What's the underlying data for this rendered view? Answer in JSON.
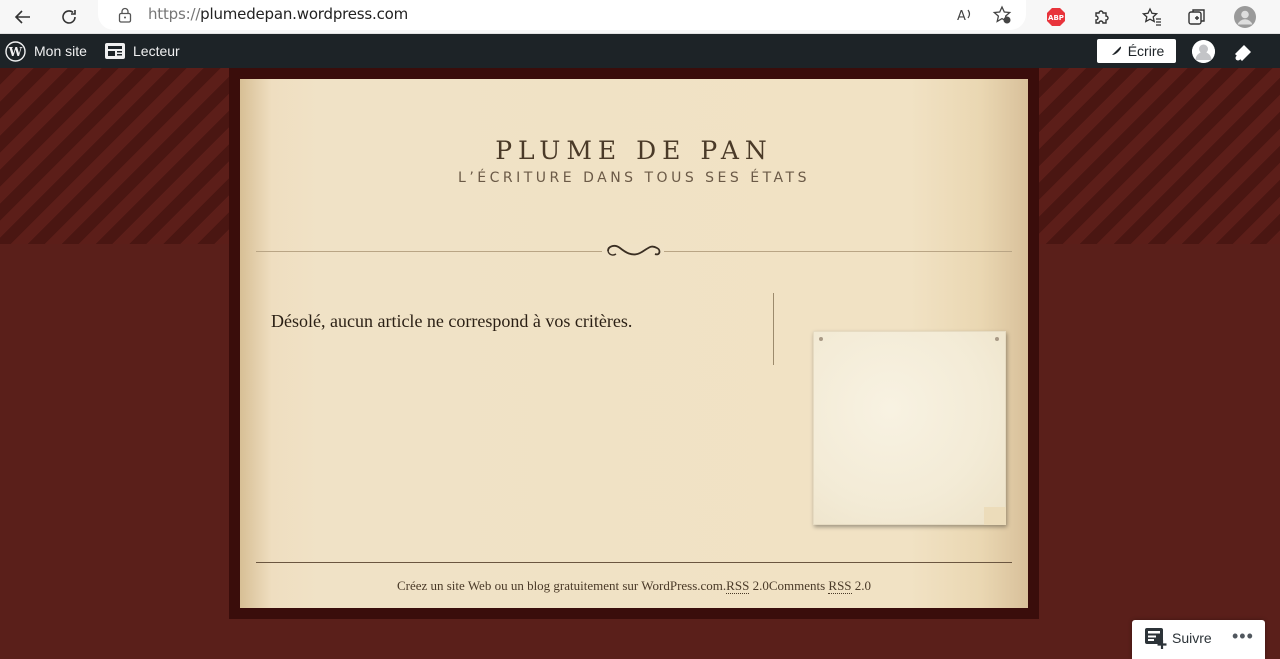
{
  "browser": {
    "url_protocol": "https://",
    "url_host": "plumedepan.wordpress.com"
  },
  "admin_bar": {
    "my_site": "Mon site",
    "reader": "Lecteur",
    "write": "Écrire"
  },
  "site": {
    "title": "PLUME DE PAN",
    "description": "L’ÉCRITURE DANS TOUS SES ÉTATS"
  },
  "main": {
    "message": "Désolé, aucun article ne correspond à vos critères."
  },
  "footer": {
    "credit": "Créez un site Web ou un blog gratuitement sur WordPress.com.",
    "rss_abbr": "RSS",
    "rss_version": " 2.0",
    "comments_label": "Comments ",
    "comments_rss_abbr": "RSS",
    "comments_version": " 2.0"
  },
  "follow_widget": {
    "label": "Suivre",
    "more": "•••"
  },
  "colors": {
    "background": "#5a1f1a",
    "admin_bar": "#1d2327",
    "paper": "#f1e2c4"
  }
}
